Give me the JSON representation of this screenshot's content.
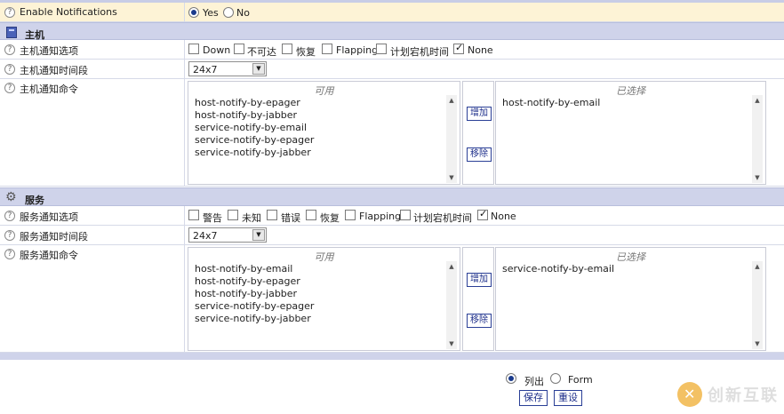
{
  "enable_notifications": {
    "label": "Enable Notifications",
    "yes_label": "Yes",
    "no_label": "No",
    "selected": "Yes"
  },
  "host": {
    "section_title": "主机",
    "options_label": "主机通知选项",
    "options": [
      {
        "label": "Down",
        "checked": false
      },
      {
        "label": "不可达",
        "checked": false
      },
      {
        "label": "恢复",
        "checked": false
      },
      {
        "label": "Flapping",
        "checked": false
      },
      {
        "label": "计划宕机时间",
        "checked": false
      },
      {
        "label": "None",
        "checked": true
      }
    ],
    "period_label": "主机通知时间段",
    "period_value": "24x7",
    "commands_label": "主机通知命令",
    "available_title": "可用",
    "selected_title": "已选择",
    "available": [
      "host-notify-by-epager",
      "host-notify-by-jabber",
      "service-notify-by-email",
      "service-notify-by-epager",
      "service-notify-by-jabber"
    ],
    "selected": [
      "host-notify-by-email"
    ],
    "add_label": "增加",
    "remove_label": "移除"
  },
  "service": {
    "section_title": "服务",
    "options_label": "服务通知选项",
    "options": [
      {
        "label": "警告",
        "checked": false
      },
      {
        "label": "未知",
        "checked": false
      },
      {
        "label": "错误",
        "checked": false
      },
      {
        "label": "恢复",
        "checked": false
      },
      {
        "label": "Flapping",
        "checked": false
      },
      {
        "label": "计划宕机时间",
        "checked": false
      },
      {
        "label": "None",
        "checked": true
      }
    ],
    "period_label": "服务通知时间段",
    "period_value": "24x7",
    "commands_label": "服务通知命令",
    "available_title": "可用",
    "selected_title": "已选择",
    "available": [
      "host-notify-by-email",
      "host-notify-by-epager",
      "host-notify-by-jabber",
      "service-notify-by-epager",
      "service-notify-by-jabber"
    ],
    "selected": [
      "service-notify-by-email"
    ],
    "add_label": "增加",
    "remove_label": "移除"
  },
  "footer": {
    "list_label": "列出",
    "form_label": "Form",
    "selected_mode": "列出",
    "save_label": "保存",
    "reset_label": "重设"
  },
  "watermark": {
    "text": "创新互联"
  },
  "icons": [
    "help-icon",
    "host-icon",
    "gear-icon",
    "scroll-up-icon",
    "scroll-down-icon",
    "dropdown-arrow-icon"
  ]
}
